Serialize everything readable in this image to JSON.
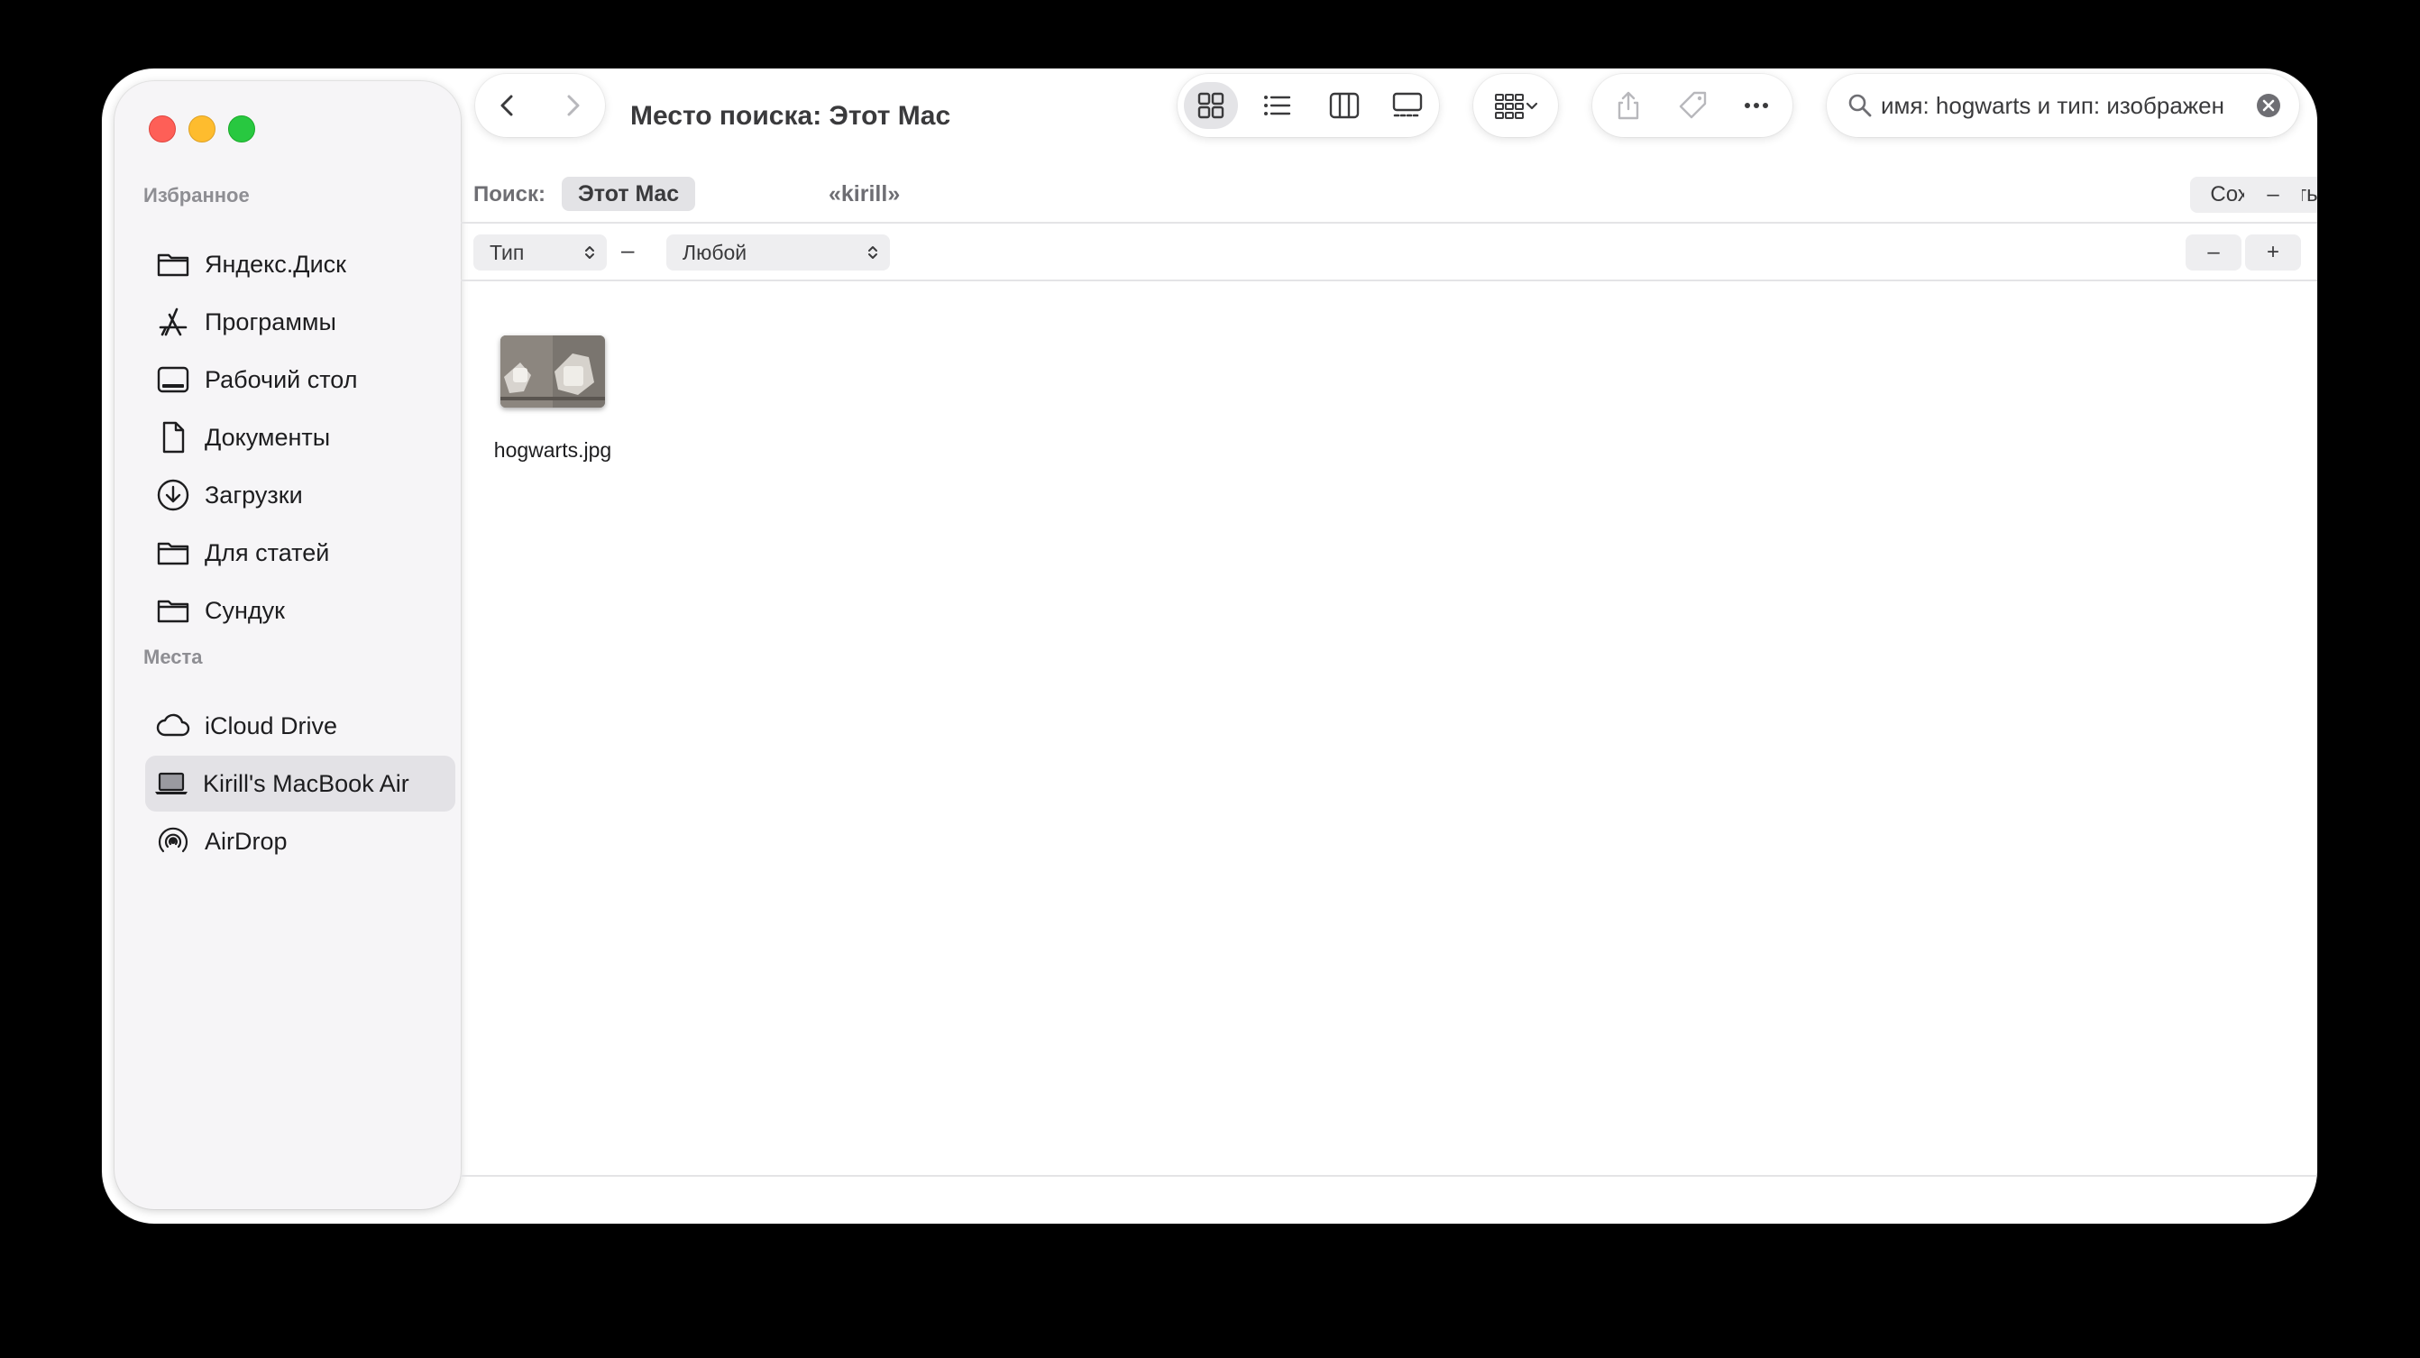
{
  "window": {
    "title": "Место поиска: Этот Mac"
  },
  "sidebar": {
    "sections": [
      {
        "header": "Избранное",
        "items": [
          {
            "label": "Яндекс.Диск",
            "icon": "folder-icon"
          },
          {
            "label": "Программы",
            "icon": "applications-icon"
          },
          {
            "label": "Рабочий стол",
            "icon": "desktop-icon"
          },
          {
            "label": "Документы",
            "icon": "document-icon"
          },
          {
            "label": "Загрузки",
            "icon": "download-icon"
          },
          {
            "label": "Для статей",
            "icon": "folder-icon"
          },
          {
            "label": "Сундук",
            "icon": "folder-icon"
          }
        ]
      },
      {
        "header": "Места",
        "items": [
          {
            "label": "iCloud Drive",
            "icon": "cloud-icon"
          },
          {
            "label": "Kirill's MacBook Air",
            "icon": "laptop-icon",
            "selected": true
          },
          {
            "label": "AirDrop",
            "icon": "airdrop-icon"
          }
        ]
      }
    ]
  },
  "toolbar": {
    "view_modes": [
      "icon-view",
      "list-view",
      "column-view",
      "gallery-view"
    ],
    "active_view": "icon-view"
  },
  "search": {
    "value": "имя: hogwarts и тип: изображен"
  },
  "scope": {
    "label": "Поиск:",
    "options": [
      "Этот Mac",
      "«kirill»"
    ],
    "selected": "Этот Mac",
    "save_label": "Сохранить",
    "remove_label": "–"
  },
  "criteria": {
    "attribute": "Тип",
    "separator": "–",
    "value": "Любой",
    "remove_label": "–",
    "add_label": "+"
  },
  "results": [
    {
      "name": "hogwarts.jpg"
    }
  ],
  "colors": {
    "close": "#fe5f57",
    "minimize": "#febc2e",
    "zoom": "#28c840",
    "sidebar_bg": "#f6f5f7",
    "selection": "#e3e2e6"
  }
}
